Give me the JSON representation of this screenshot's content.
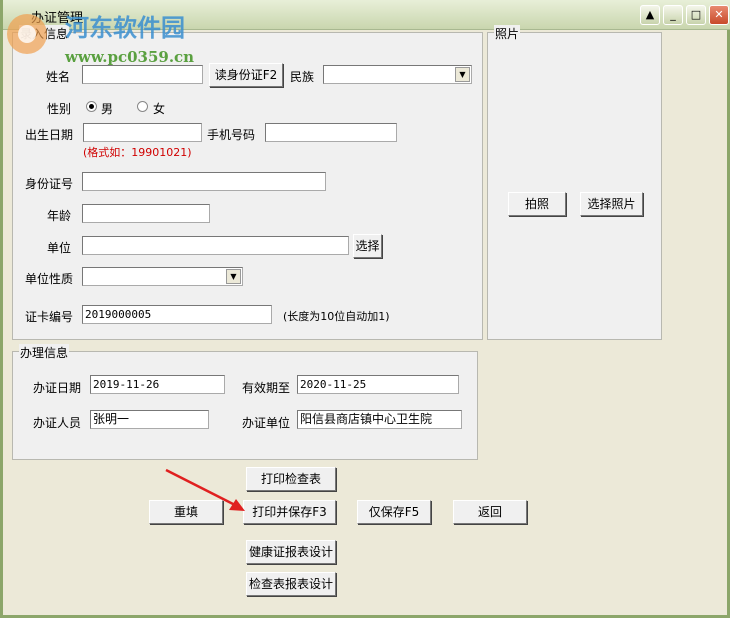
{
  "window": {
    "title": "办证管理",
    "controls": [
      "help",
      "minimize",
      "maximize",
      "close"
    ]
  },
  "watermark": {
    "name": "河东软件园",
    "url": "www.pc0359.cn"
  },
  "entry": {
    "group_label": "录入信息",
    "name_label": "姓名",
    "name_value": "",
    "read_id_button": "读身份证F2",
    "ethnicity_label": "民族",
    "ethnicity_value": "",
    "gender_label": "性别",
    "gender_options": [
      "男",
      "女"
    ],
    "gender_selected": "男",
    "birth_label": "出生日期",
    "birth_value": "",
    "phone_label": "手机号码",
    "phone_value": "",
    "birth_hint": "(格式如：19901021)",
    "id_label": "身份证号",
    "id_value": "",
    "age_label": "年龄",
    "age_value": "",
    "unit_label": "单位",
    "unit_value": "",
    "unit_select_button": "选择",
    "unit_type_label": "单位性质",
    "unit_type_value": "",
    "card_no_label": "证卡编号",
    "card_no_value": "2019000005",
    "card_no_hint": "(长度为10位自动加1)"
  },
  "photo": {
    "group_label": "照片",
    "take_button": "拍照",
    "choose_button": "选择照片"
  },
  "process": {
    "group_label": "办理信息",
    "date_label": "办证日期",
    "date_value": "2019-11-26",
    "valid_label": "有效期至",
    "valid_value": "2020-11-25",
    "staff_label": "办证人员",
    "staff_value": "张明一",
    "org_label": "办证单位",
    "org_value": "阳信县商店镇中心卫生院"
  },
  "actions": {
    "print_check": "打印检查表",
    "reset": "重填",
    "print_save": "打印并保存F3",
    "save_only": "仅保存F5",
    "back": "返回",
    "health_design": "健康证报表设计",
    "check_design": "检查表报表设计"
  },
  "colors": {
    "hint": "#d00000",
    "arrow": "#e02020"
  }
}
